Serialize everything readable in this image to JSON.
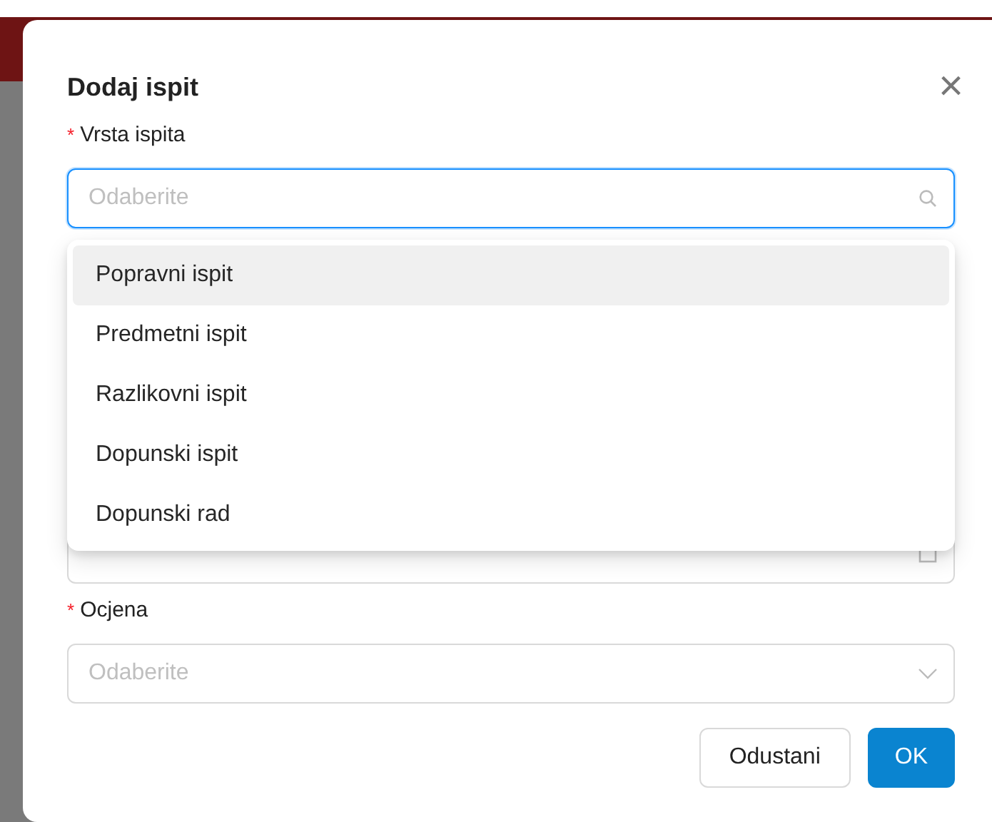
{
  "dialog": {
    "title": "Dodaj ispit",
    "close": "×"
  },
  "fields": [
    {
      "kind": "search",
      "label": "Vrsta ispita",
      "required_mark": "*",
      "placeholder": "Odaberite",
      "focused": true
    },
    {
      "kind": "date",
      "focused": false
    },
    {
      "kind": "select",
      "label": "Ocjena",
      "required_mark": "*",
      "placeholder": "Odaberite",
      "focused": false
    }
  ],
  "dropdown": {
    "options": [
      {
        "label": "Popravni ispit",
        "selected": true
      },
      {
        "label": "Predmetni ispit",
        "selected": false
      },
      {
        "label": "Razlikovni ispit",
        "selected": false
      },
      {
        "label": "Dopunski ispit",
        "selected": false
      },
      {
        "label": "Dopunski rad",
        "selected": false
      }
    ]
  },
  "buttons": [
    {
      "label": "Odustani",
      "kind": "secondary"
    },
    {
      "label": "OK",
      "kind": "primary"
    }
  ]
}
